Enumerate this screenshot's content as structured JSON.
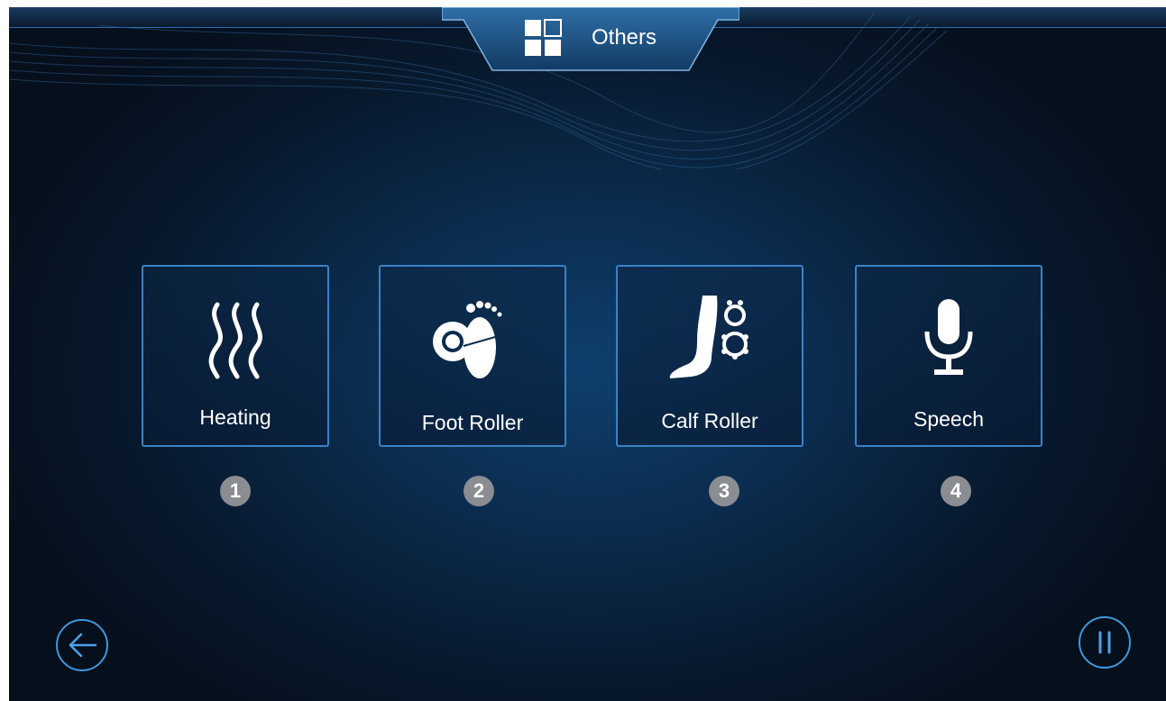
{
  "header": {
    "title": "Others",
    "icon": "grid-icon"
  },
  "tiles": [
    {
      "label": "Heating",
      "icon": "heat-waves-icon",
      "number": "1"
    },
    {
      "label": "Foot Roller",
      "icon": "foot-roller-icon",
      "number": "2"
    },
    {
      "label": "Calf Roller",
      "icon": "calf-roller-icon",
      "number": "3"
    },
    {
      "label": "Speech",
      "icon": "microphone-icon",
      "number": "4"
    }
  ],
  "controls": {
    "back": "back-arrow-icon",
    "pause": "pause-icon"
  },
  "colors": {
    "accent": "#3a82c6",
    "background": "#0b2c4e",
    "badge": "#8a8d92"
  }
}
